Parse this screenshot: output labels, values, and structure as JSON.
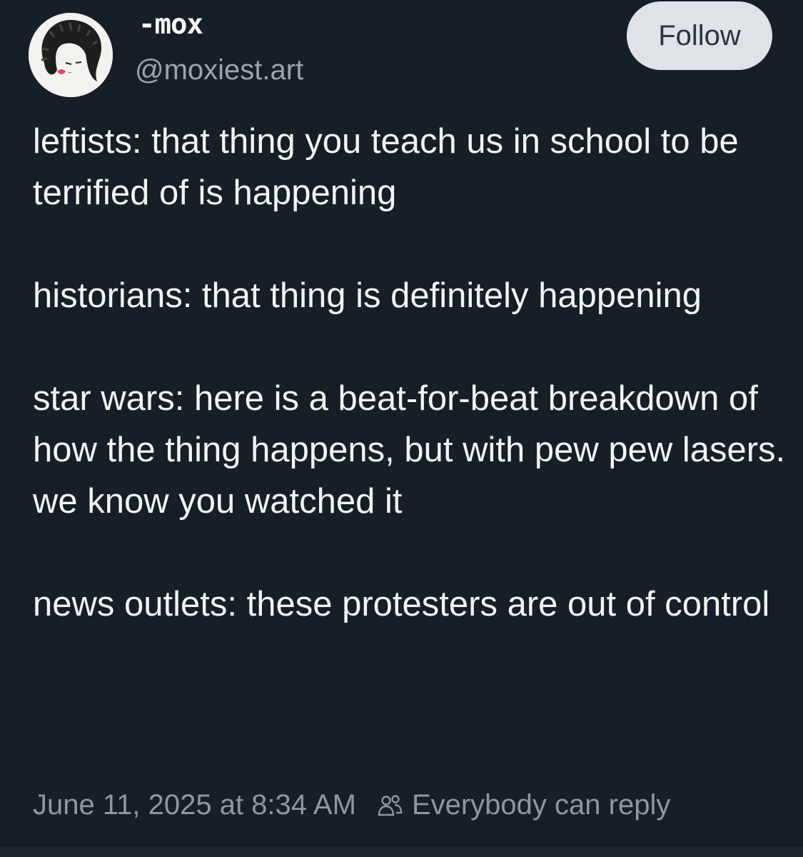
{
  "author": {
    "display_name": "-mox",
    "handle": "@moxiest.art",
    "avatar_icon": "avatar-drawing"
  },
  "follow_label": "Follow",
  "post": {
    "paragraphs": [
      "leftists: that thing you teach us in school to be terrified of is happening",
      "historians: that thing is definitely happening",
      "star wars: here is a beat-for-beat breakdown of how the thing happens, but with pew pew lasers. we know you watched it",
      "news outlets: these protesters are out of control"
    ]
  },
  "footer": {
    "timestamp": "June 11, 2025 at 8:34 AM",
    "reply_setting": "Everybody can reply",
    "reply_icon": "people-icon"
  },
  "colors": {
    "background": "#161e27",
    "text": "#f2f4f6",
    "muted": "#8c97a3",
    "follow_bg": "#dfe3e8"
  }
}
